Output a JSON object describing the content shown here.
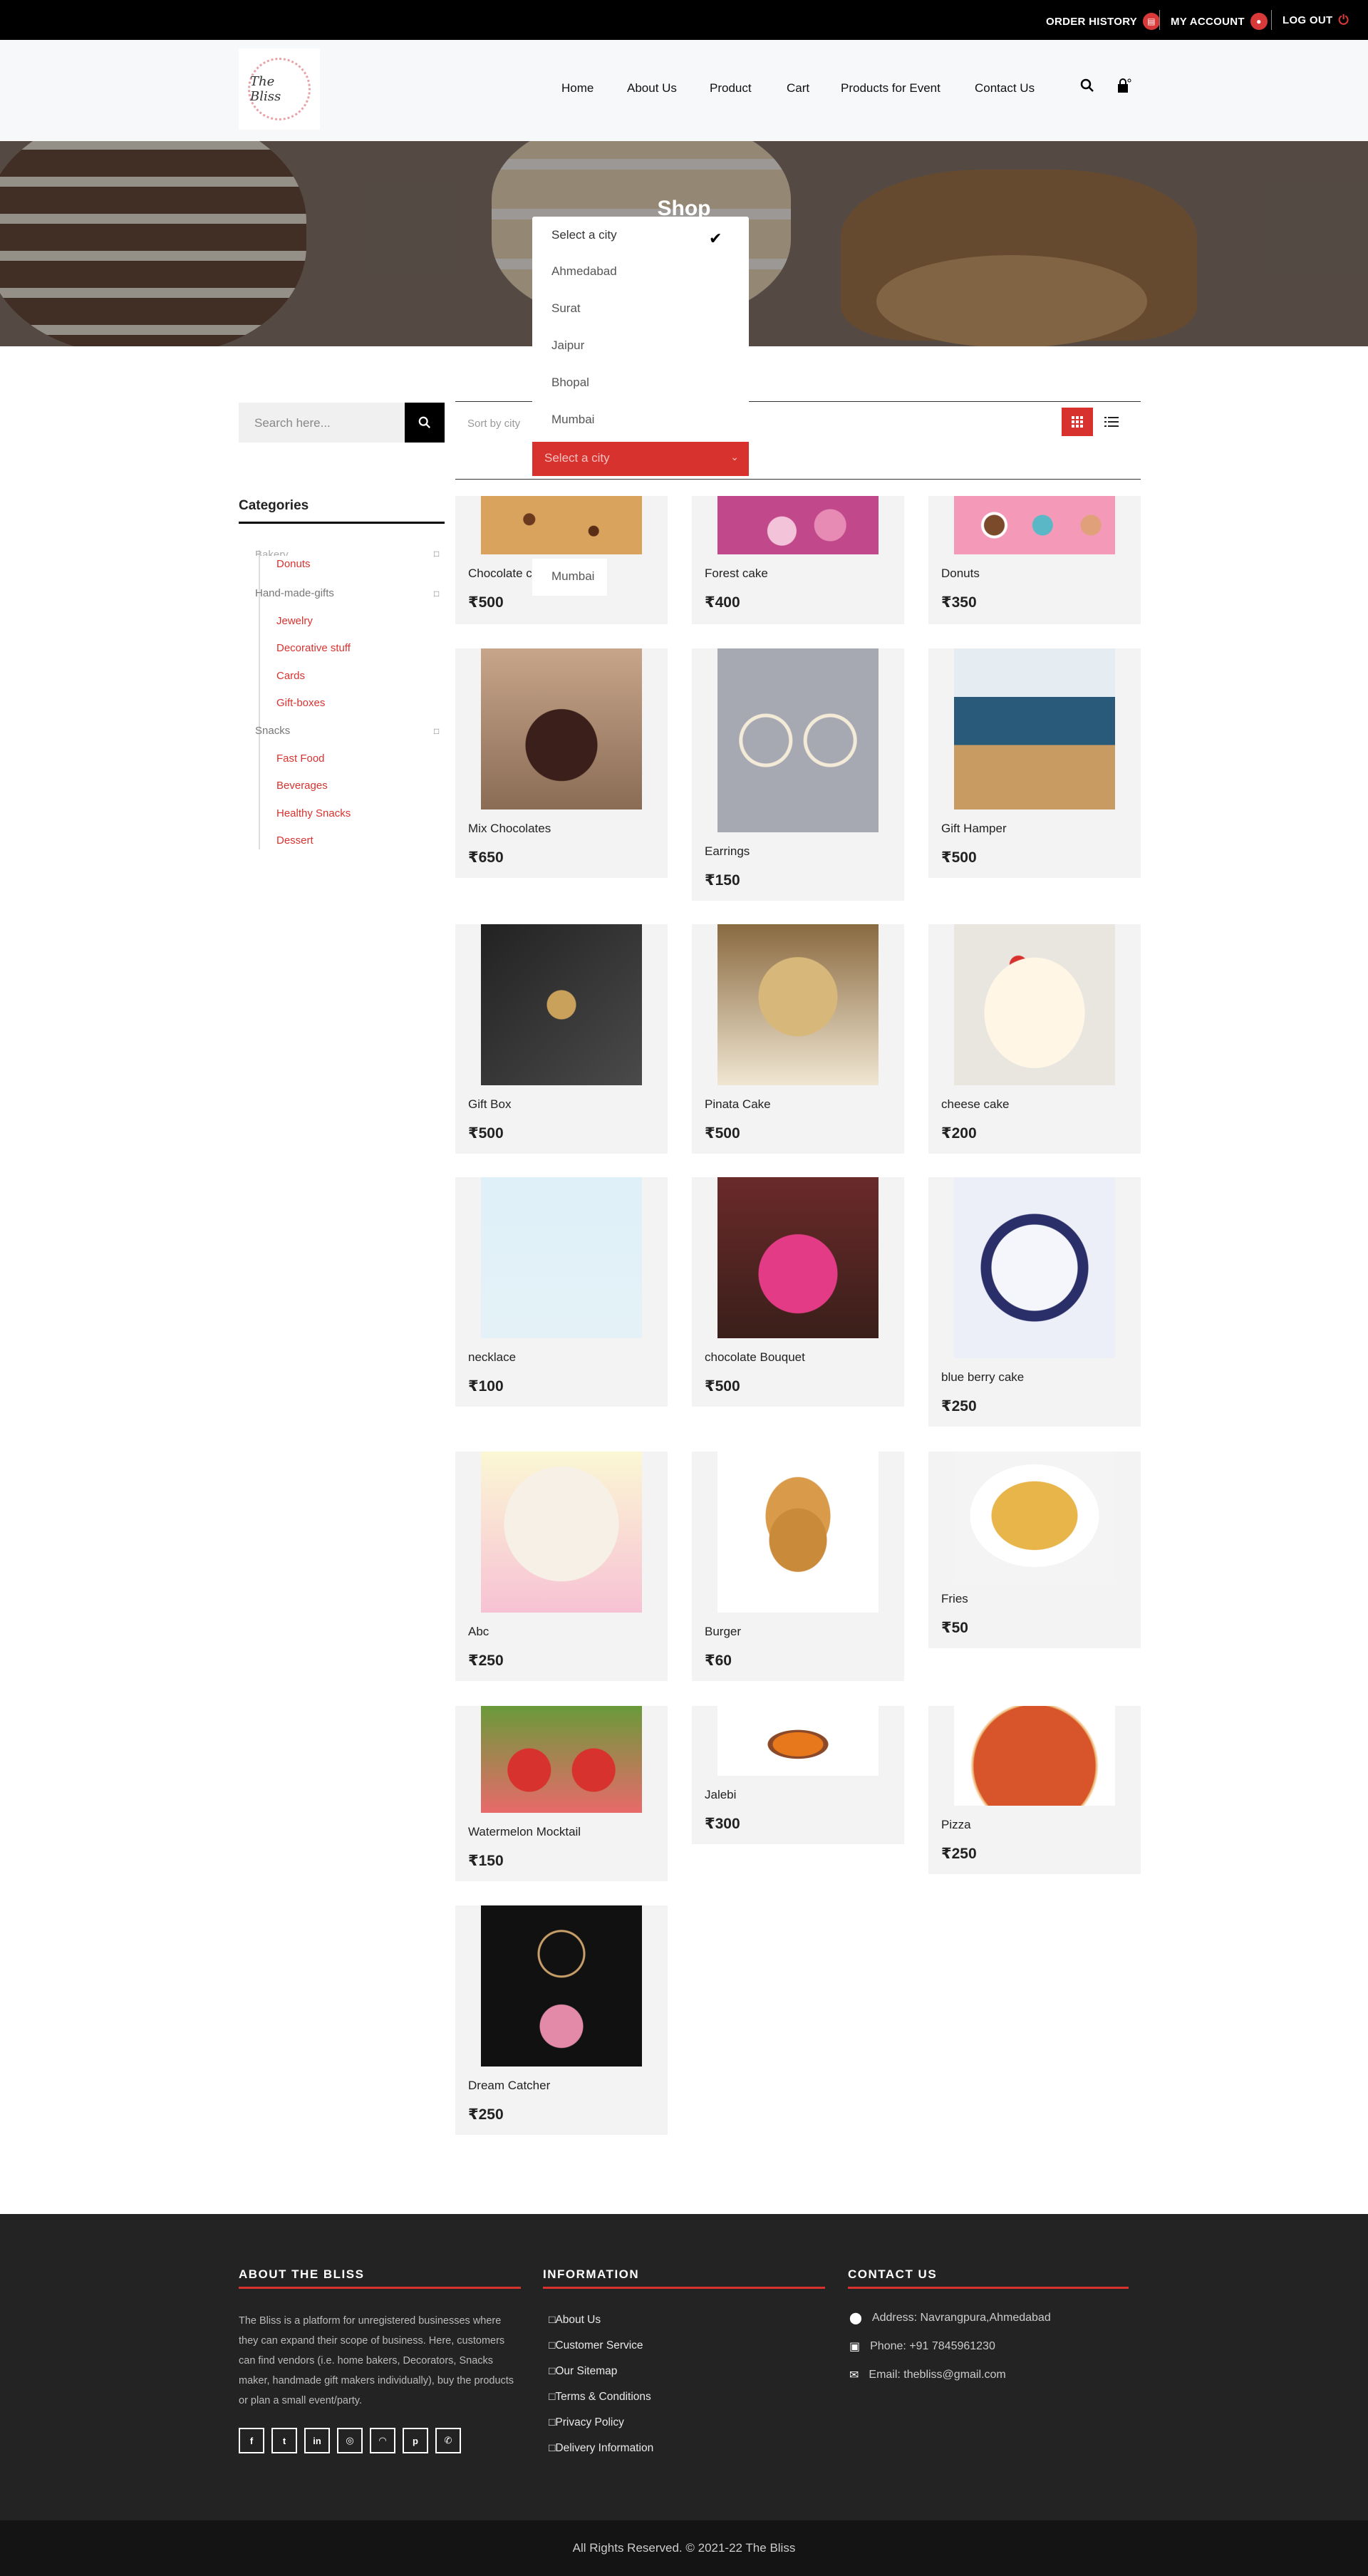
{
  "topbar": {
    "order_history": "ORDER HISTORY",
    "my_account": "MY ACCOUNT",
    "log_out": "LOG OUT"
  },
  "logo_text": "The Bliss",
  "nav": [
    "Home",
    "About Us",
    "Product",
    "Cart",
    "Products for Event",
    "Contact Us"
  ],
  "banner": {
    "title": "Shop"
  },
  "search": {
    "placeholder": "Search here..."
  },
  "categories": {
    "title": "Categories",
    "parents": [
      "Bakery",
      "Hand-made-gifts",
      "Snacks"
    ],
    "children": [
      "Donuts",
      "Jewelry",
      "Decorative stuff",
      "Cards",
      "Gift-boxes",
      "Fast Food",
      "Beverages",
      "Healthy Snacks",
      "Dessert"
    ]
  },
  "sort": {
    "label": "Sort by city",
    "selected": "Select a city",
    "options": [
      "Select a city",
      "Ahmedabad",
      "Surat",
      "Jaipur",
      "Bhopal",
      "Mumbai"
    ],
    "extra_option": "Mumbai"
  },
  "products": [
    {
      "name": "Chocolate cookies",
      "price": "₹500"
    },
    {
      "name": "Forest cake",
      "price": "₹400"
    },
    {
      "name": "Donuts",
      "price": "₹350"
    },
    {
      "name": "Mix Chocolates",
      "price": "₹650"
    },
    {
      "name": "Earrings",
      "price": "₹150"
    },
    {
      "name": "Gift Hamper",
      "price": "₹500"
    },
    {
      "name": "Gift Box",
      "price": "₹500"
    },
    {
      "name": "Pinata Cake",
      "price": "₹500"
    },
    {
      "name": "cheese cake",
      "price": "₹200"
    },
    {
      "name": "necklace",
      "price": "₹100"
    },
    {
      "name": "chocolate Bouquet",
      "price": "₹500"
    },
    {
      "name": "blue berry cake",
      "price": "₹250"
    },
    {
      "name": "Abc",
      "price": "₹250"
    },
    {
      "name": "Burger",
      "price": "₹60"
    },
    {
      "name": "Fries",
      "price": "₹50"
    },
    {
      "name": "Watermelon Mocktail",
      "price": "₹150"
    },
    {
      "name": "Jalebi",
      "price": "₹300"
    },
    {
      "name": "Pizza",
      "price": "₹250"
    },
    {
      "name": "Dream Catcher",
      "price": "₹250"
    }
  ],
  "footer": {
    "about_title": "ABOUT THE BLISS",
    "about_text": "The Bliss is a platform for unregistered businesses where they can expand their scope of business. Here, customers can find vendors (i.e. home bakers, Decorators, Snacks maker, handmade gift makers individually), buy the products or plan a small event/party.",
    "info_title": "INFORMATION",
    "info_links": [
      "About Us",
      "Customer Service",
      "Our Sitemap",
      "Terms & Conditions",
      "Privacy Policy",
      "Delivery Information"
    ],
    "contact_title": "CONTACT US",
    "address": "Address: Navrangpura,Ahmedabad",
    "phone": "Phone: +91 7845961230",
    "email": "Email: thebliss@gmail.com",
    "copyright": "All Rights Reserved. © 2021-22 The Bliss"
  }
}
